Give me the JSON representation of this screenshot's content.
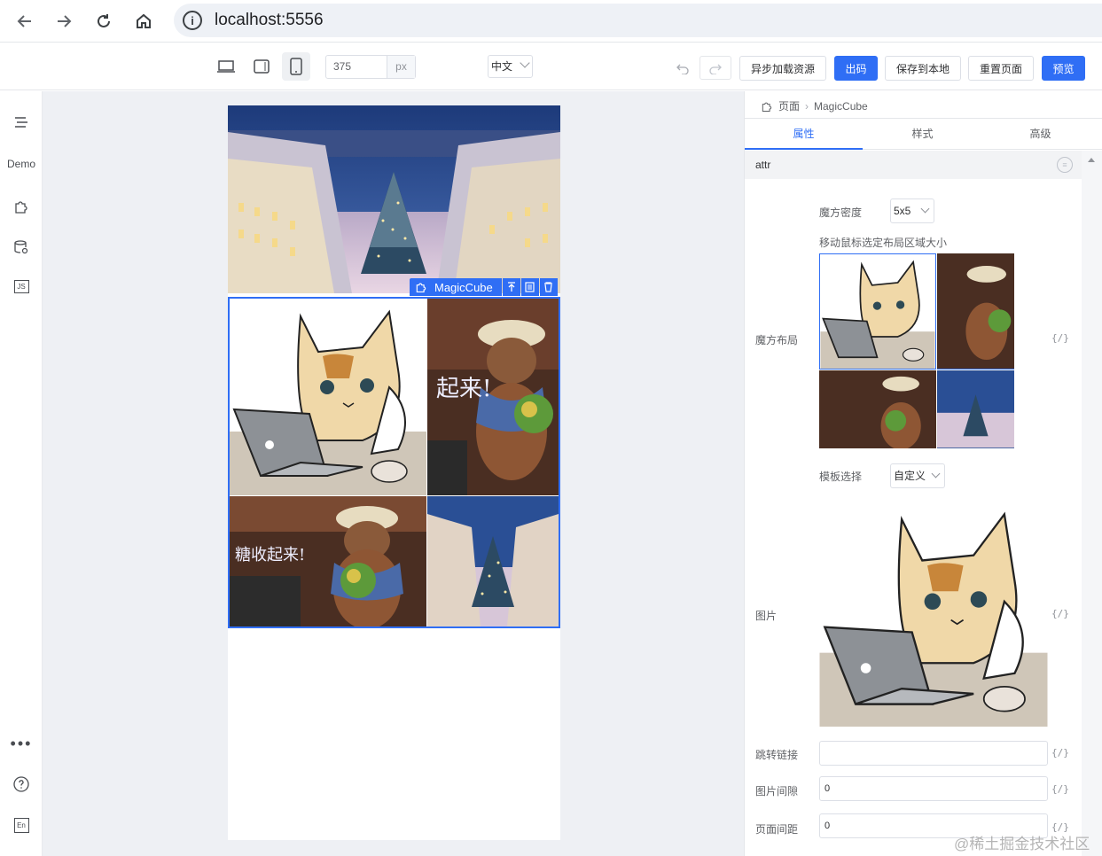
{
  "browser": {
    "url": "localhost:5556",
    "info_symbol": "i"
  },
  "toolbar": {
    "width_value": "375",
    "width_unit": "px",
    "language": "中文",
    "async_load_label": "异步加载资源",
    "export_code_label": "出码",
    "save_local_label": "保存到本地",
    "reset_page_label": "重置页面",
    "preview_label": "预览"
  },
  "left_sidebar": {
    "demo_label": "Demo",
    "js_label": "JS",
    "en_label": "En"
  },
  "canvas": {
    "component_name": "MagicCube"
  },
  "panel": {
    "breadcrumb_root": "页面",
    "breadcrumb_current": "MagicCube",
    "tabs": [
      "属性",
      "样式",
      "高级"
    ],
    "active_tab": "属性",
    "section_title": "attr",
    "density_label": "魔方密度",
    "density_value": "5x5",
    "hint": "移动鼠标选定布局区域大小",
    "layout_label": "魔方布局",
    "template_label": "模板选择",
    "template_value": "自定义",
    "image_label": "图片",
    "link_label": "跳转链接",
    "link_value": "",
    "gap_label": "图片间隙",
    "gap_value": "0",
    "page_margin_label": "页面间距",
    "page_margin_value": "0",
    "expr_symbol": "{/}"
  },
  "watermark": "@稀土掘金技术社区",
  "colors": {
    "accent": "#2f6ef5",
    "canvas_bg": "#eef0f4"
  }
}
